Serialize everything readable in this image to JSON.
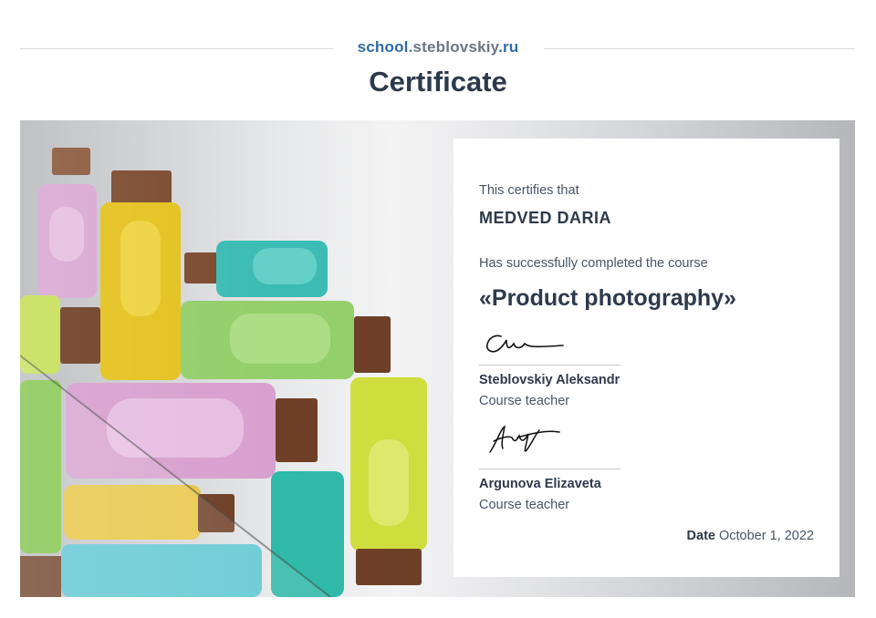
{
  "header": {
    "site_part1": "school",
    "site_part2": ".steblovskiy",
    "site_part3": ".ru",
    "title": "Certificate"
  },
  "certificate": {
    "intro": "This certifies that",
    "recipient": "MEDVED DARIA",
    "completed_text": "Has successfully completed the course",
    "course": "«Product photography»",
    "teachers": [
      {
        "name": "Steblovskiy Aleksandr",
        "role": "Course teacher"
      },
      {
        "name": "Argunova Elizaveta",
        "role": "Course teacher"
      }
    ],
    "date_label": "Date",
    "date_value": "October 1, 2022"
  },
  "colors": {
    "brand_blue": "#2e6da4",
    "brand_gray": "#6b7785",
    "text_dark": "#2d3a4b"
  }
}
